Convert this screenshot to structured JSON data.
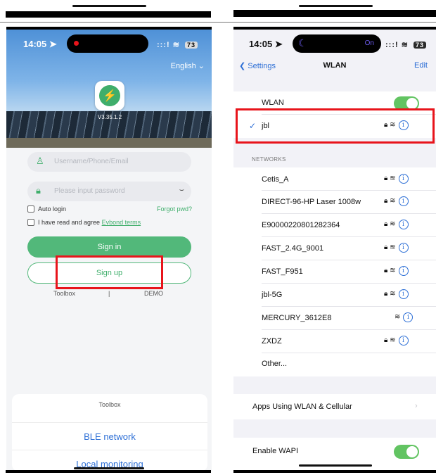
{
  "left_phone": {
    "status_time": "14:05",
    "status_signal": ":::!",
    "battery": "73",
    "language": "English",
    "version": "V3.35.1.2",
    "username_placeholder": "Username/Phone/Email",
    "password_placeholder": "Please input password",
    "auto_login": "Auto login",
    "forgot": "Forgot pwd?",
    "agree_prefix": "I have read and agree",
    "agree_link": "Evbond terms",
    "sign_in": "Sign in",
    "sign_up": "Sign up",
    "toolbox": "Toolbox",
    "divider": "|",
    "demo": "DEMO",
    "sheet_title": "Toolbox",
    "sheet_options": [
      "BLE network",
      "Local monitoring"
    ]
  },
  "right_phone": {
    "status_time": "14:05",
    "focus_label": "On",
    "status_signal": ":::!",
    "battery": "73",
    "back_label": "Settings",
    "title": "WLAN",
    "edit": "Edit",
    "wlan_label": "WLAN",
    "connected_network": "jbl",
    "networks_header": "NETWORKS",
    "networks": [
      {
        "name": "Cetis_A",
        "locked": true
      },
      {
        "name": "DIRECT-96-HP Laser 1008w",
        "locked": true
      },
      {
        "name": "E90000220801282364",
        "locked": true
      },
      {
        "name": "FAST_2.4G_9001",
        "locked": true
      },
      {
        "name": "FAST_F951",
        "locked": true
      },
      {
        "name": "jbl-5G",
        "locked": true
      },
      {
        "name": "MERCURY_3612E8",
        "locked": false
      },
      {
        "name": "ZXDZ",
        "locked": true
      }
    ],
    "other": "Other...",
    "apps_using": "Apps Using WLAN & Cellular",
    "enable_wapi": "Enable WAPI"
  },
  "colors": {
    "accent_green": "#52b87a",
    "ios_blue": "#2d6fd6",
    "highlight_red": "#e8141b",
    "toggle_green": "#62c462"
  }
}
